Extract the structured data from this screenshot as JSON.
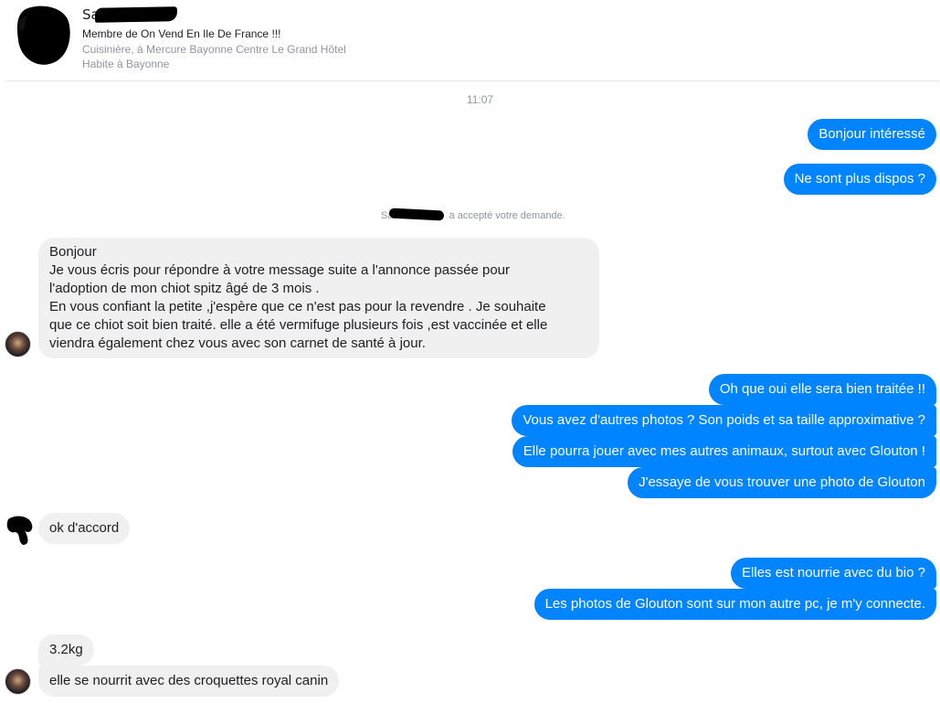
{
  "header": {
    "name_visible": "Sa",
    "line1": "Membre de On Vend En Ile De France !!!",
    "line2": "Cuisinière, à Mercure Bayonne Centre Le Grand Hôtel",
    "line3": "Habite à Bayonne"
  },
  "timestamp": "11:07",
  "system": {
    "name_visible": "Sa",
    "text": "a accepté votre demande."
  },
  "messages": {
    "out1": "Bonjour intéressé",
    "out2": "Ne sont plus dispos ?",
    "in1": [
      "Bonjour",
      "Je vous écris pour répondre à votre message suite a l'annonce passée pour",
      "l'adoption de mon chiot spitz âgé de 3 mois .",
      "En vous confiant la petite ,j'espère que ce n'est pas pour la revendre . Je souhaite",
      "que ce chiot soit bien traité. elle a été vermifuge plusieurs fois ,est vaccinée et elle",
      "viendra également chez vous avec  son carnet de santé à jour."
    ],
    "out3": "Oh que oui elle sera bien traitée !!",
    "out4": "Vous avez d'autres photos ? Son poids et sa taille approximative ?",
    "out5": "Elle pourra jouer avec mes autres animaux, surtout avec Glouton !",
    "out6": "J'essaye de vous trouver une photo de Glouton",
    "in2": "ok d'accord",
    "out7": "Elles est nourrie avec du bio ?",
    "out8": "Les photos de Glouton sont sur mon autre pc, je m'y connecte.",
    "in3": "3.2kg",
    "in4": "elle se nourrit avec des croquettes royal canin"
  },
  "colors": {
    "outgoing_bubble": "#0084ff",
    "incoming_bubble": "#f1f0f0",
    "meta_text": "#90949c"
  }
}
